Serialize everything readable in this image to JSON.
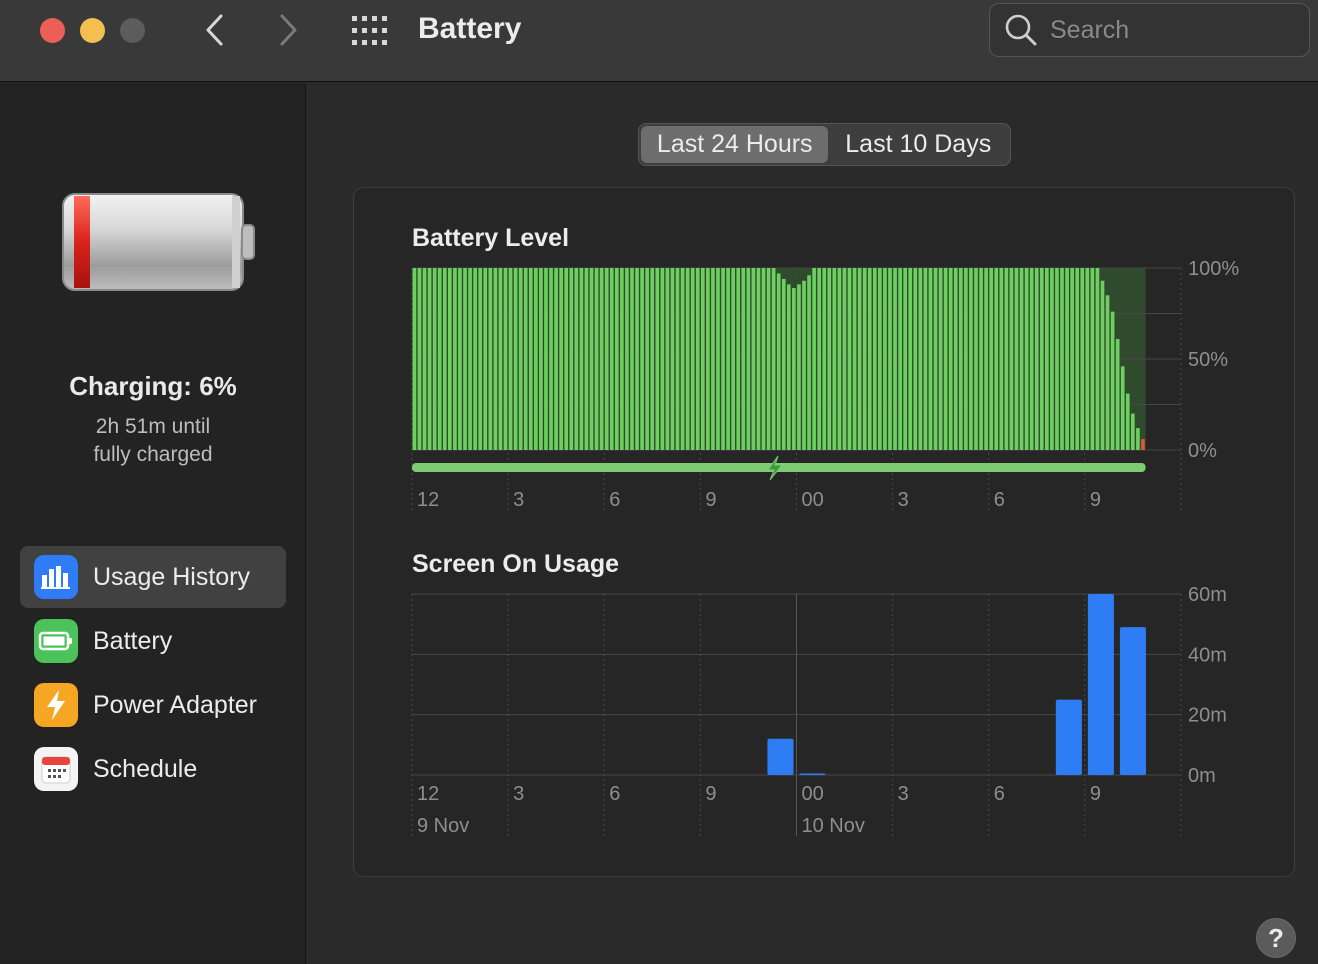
{
  "window": {
    "title": "Battery"
  },
  "search": {
    "placeholder": "Search"
  },
  "status": {
    "charging": "Charging: 6%",
    "time_line1": "2h 51m until",
    "time_line2": "fully charged"
  },
  "sidebar": {
    "items": [
      {
        "label": "Usage History",
        "icon": "usage-history-icon",
        "selected": true,
        "color": "#2e7cf6"
      },
      {
        "label": "Battery",
        "icon": "battery-icon",
        "selected": false,
        "color": "#4cc25a"
      },
      {
        "label": "Power Adapter",
        "icon": "power-adapter-icon",
        "selected": false,
        "color": "#f5a623"
      },
      {
        "label": "Schedule",
        "icon": "calendar-icon",
        "selected": false,
        "color": "#ffffff"
      }
    ]
  },
  "tabs": [
    {
      "label": "Last 24 Hours",
      "active": true
    },
    {
      "label": "Last 10 Days",
      "active": false
    }
  ],
  "help": {
    "label": "?"
  },
  "chart_data": [
    {
      "type": "bar",
      "title": "Battery Level",
      "ylim": [
        0,
        100
      ],
      "y_ticks": [
        "100%",
        "50%",
        "0%"
      ],
      "x_ticks": [
        "12",
        "3",
        "6",
        "9",
        "00",
        "3",
        "6",
        "9"
      ],
      "colors": {
        "bar": "#6ccf5f",
        "low_bar": "#e0533f",
        "charging_strip": "#7ecb74"
      },
      "values": [
        100,
        100,
        100,
        100,
        100,
        100,
        100,
        100,
        100,
        100,
        100,
        100,
        100,
        100,
        100,
        100,
        100,
        100,
        100,
        100,
        100,
        100,
        100,
        100,
        100,
        100,
        100,
        100,
        100,
        100,
        100,
        100,
        100,
        100,
        100,
        100,
        100,
        100,
        100,
        100,
        100,
        100,
        100,
        100,
        100,
        100,
        100,
        100,
        100,
        100,
        100,
        100,
        100,
        100,
        100,
        100,
        100,
        100,
        100,
        100,
        100,
        100,
        100,
        100,
        100,
        100,
        100,
        100,
        100,
        100,
        100,
        100,
        97,
        94,
        91,
        89,
        91,
        93,
        96,
        100,
        100,
        100,
        100,
        100,
        100,
        100,
        100,
        100,
        100,
        100,
        100,
        100,
        100,
        100,
        100,
        100,
        100,
        100,
        100,
        100,
        100,
        100,
        100,
        100,
        100,
        100,
        100,
        100,
        100,
        100,
        100,
        100,
        100,
        100,
        100,
        100,
        100,
        100,
        100,
        100,
        100,
        100,
        100,
        100,
        100,
        100,
        100,
        100,
        100,
        100,
        100,
        100,
        100,
        100,
        100,
        100,
        93,
        85,
        76,
        61,
        46,
        31,
        20,
        12,
        6
      ]
    },
    {
      "type": "bar",
      "title": "Screen On Usage",
      "ylim": [
        0,
        60
      ],
      "y_ticks": [
        "60m",
        "40m",
        "20m",
        "0m"
      ],
      "x_ticks": [
        "12",
        "3",
        "6",
        "9",
        "00",
        "3",
        "6",
        "9"
      ],
      "date_labels": [
        "9 Nov",
        "10 Nov"
      ],
      "colors": {
        "bar": "#2f7df5"
      },
      "values": [
        0,
        0,
        0,
        0,
        0,
        0,
        0,
        0,
        0,
        0,
        0,
        12,
        0.5,
        0,
        0,
        0,
        0,
        0,
        0,
        0,
        25,
        60,
        49
      ]
    }
  ]
}
